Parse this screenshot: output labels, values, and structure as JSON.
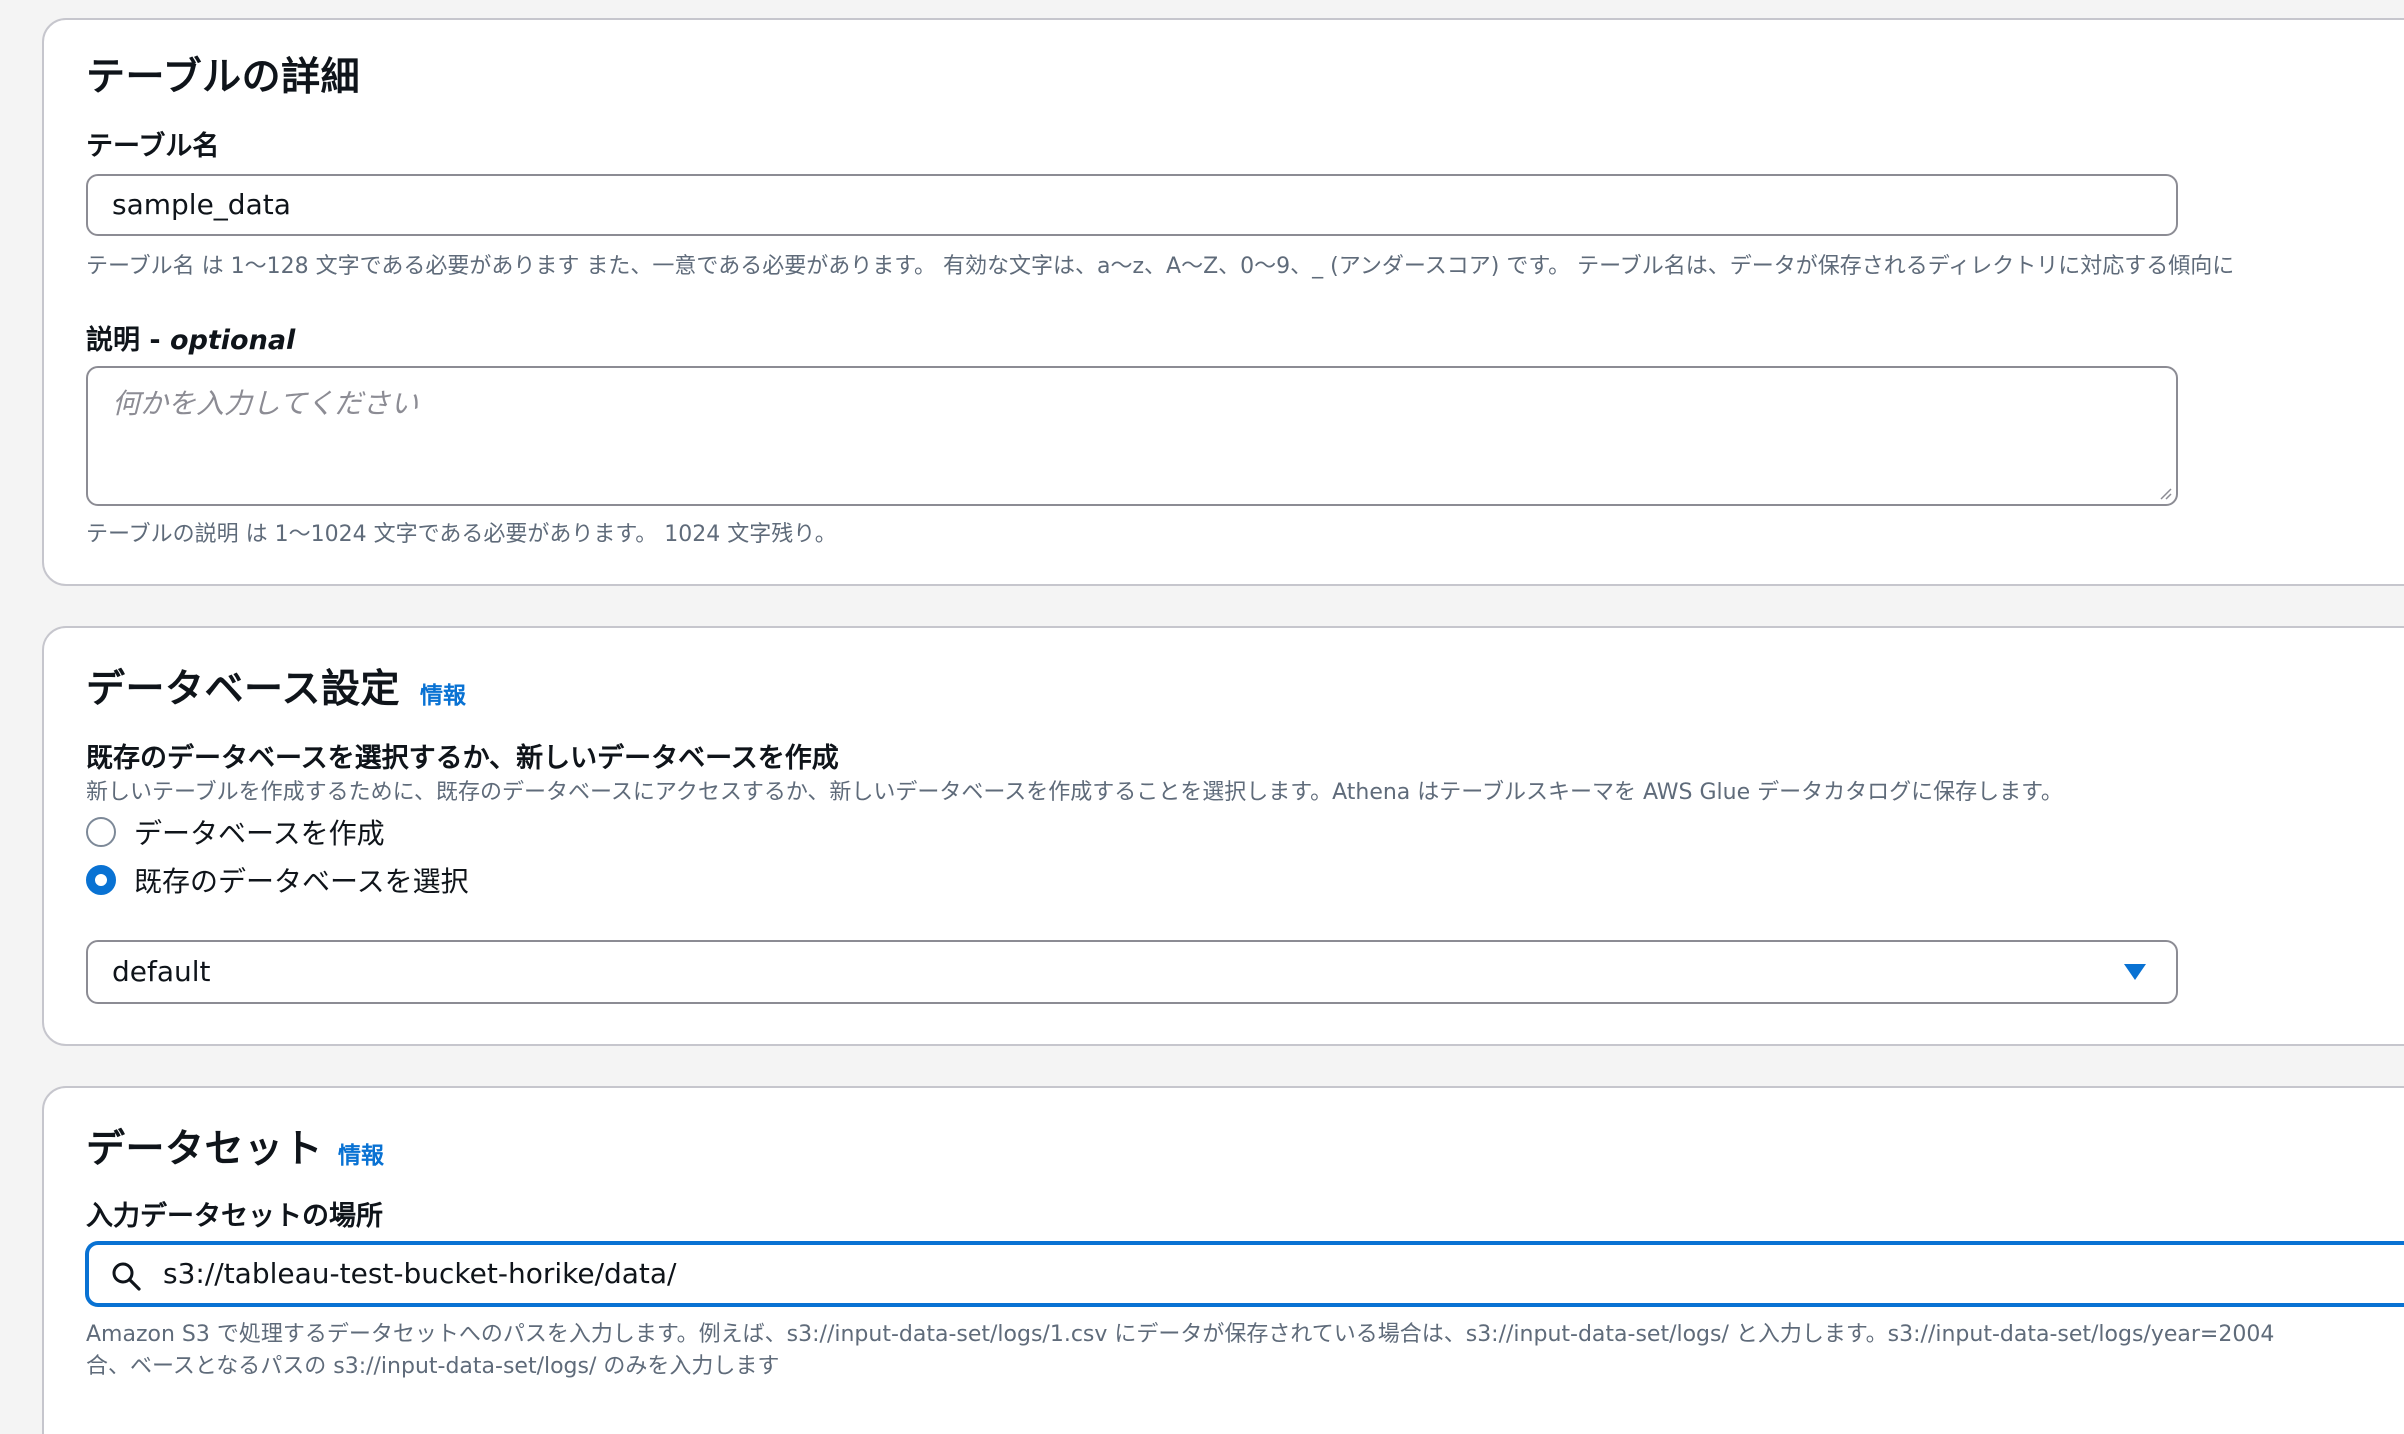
{
  "table_details": {
    "section_title": "テーブルの詳細",
    "name_label": "テーブル名",
    "name_value": "sample_data",
    "name_hint": "テーブル名 は 1〜128 文字である必要があります また、一意である必要があります。 有効な文字は、a〜z、A〜Z、0〜9、_ (アンダースコア) です。 テーブル名は、データが保存されるディレクトリに対応する傾向に",
    "description_label": "説明 - ",
    "description_optional": "optional",
    "description_placeholder": "何かを入力してください",
    "description_hint": "テーブルの説明 は 1〜1024 文字である必要があります。 1024 文字残り。"
  },
  "database_settings": {
    "section_title": "データベース設定",
    "info_link": "情報",
    "choice_label": "既存のデータベースを選択するか、新しいデータベースを作成",
    "choice_hint": "新しいテーブルを作成するために、既存のデータベースにアクセスするか、新しいデータベースを作成することを選択します。Athena はテーブルスキーマを AWS Glue データカタログに保存します。",
    "options": [
      {
        "label": "データベースを作成",
        "checked": false
      },
      {
        "label": "既存のデータベースを選択",
        "checked": true
      }
    ],
    "selected_database": "default"
  },
  "dataset": {
    "section_title": "データセット",
    "info_link": "情報",
    "location_label": "入力データセットの場所",
    "location_value": "s3://tableau-test-bucket-horike/data/",
    "location_hint_line1": "Amazon S3 で処理するデータセットへのパスを入力します。例えば、s3://input-data-set/logs/1.csv にデータが保存されている場合は、s3://input-data-set/logs/ と入力します。s3://input-data-set/logs/year=2004",
    "location_hint_line2": "合、ベースとなるパスの s3://input-data-set/logs/ のみを入力します"
  },
  "colors": {
    "accent": "#0972d3",
    "border": "#8c8c94",
    "hint_text": "#5f6b7a",
    "page_bg": "#f4f4f4"
  },
  "icons": {
    "select_caret": "caret-down-icon",
    "search": "search-icon",
    "textarea_grip": "resize-grip-icon"
  }
}
